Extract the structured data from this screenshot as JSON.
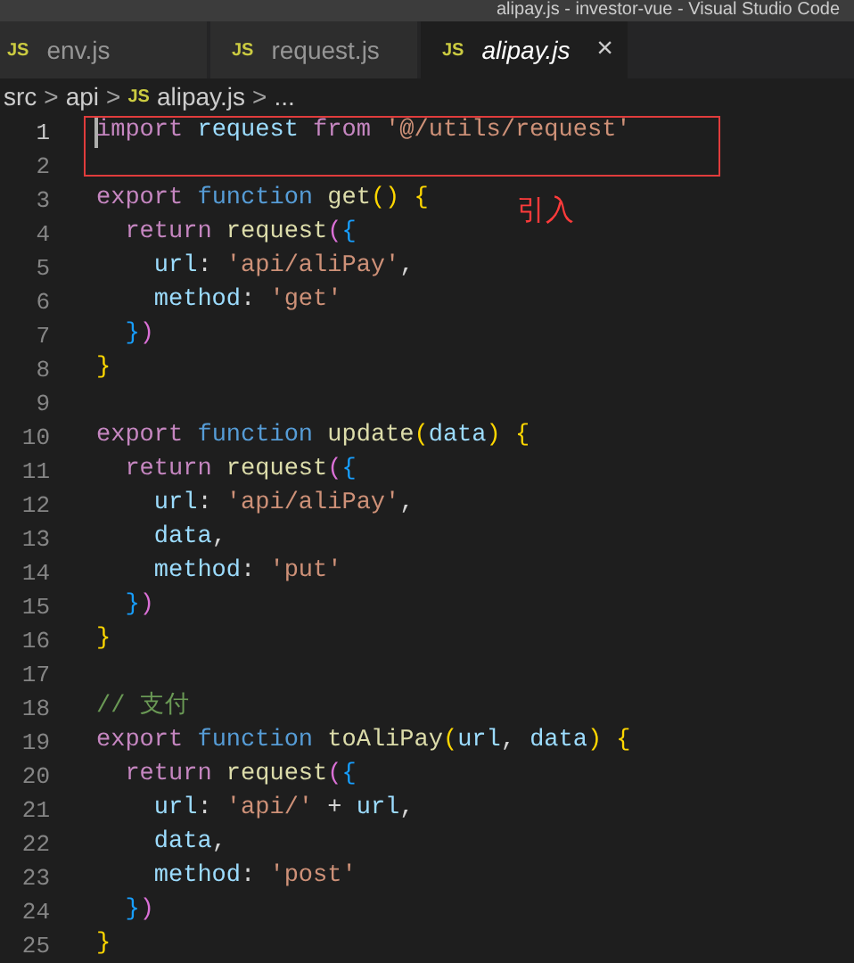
{
  "window": {
    "title": "alipay.js - investor-vue - Visual Studio Code"
  },
  "tabs": [
    {
      "icon": "JS",
      "label": "env.js",
      "selected": false
    },
    {
      "icon": "JS",
      "label": "request.js",
      "selected": false
    },
    {
      "icon": "JS",
      "label": "alipay.js",
      "selected": true,
      "close": "×"
    }
  ],
  "breadcrumb": [
    {
      "label": "src"
    },
    {
      "sep": ">"
    },
    {
      "label": "api"
    },
    {
      "sep": ">"
    },
    {
      "icon": "JS",
      "label": "alipay.js"
    },
    {
      "sep": ">"
    },
    {
      "label": "..."
    }
  ],
  "annotation": {
    "label": "引入"
  },
  "editor": {
    "lines": [
      {
        "number": "1",
        "active": true,
        "tokens": [
          {
            "text": "import ",
            "kind": "kw"
          },
          {
            "text": "request ",
            "kind": "var"
          },
          {
            "text": "from ",
            "kind": "kw"
          },
          {
            "text": "'@/utils/request'",
            "kind": "str"
          }
        ]
      },
      {
        "number": "2",
        "active": false
      },
      {
        "number": "3",
        "active": false,
        "tokens": [
          {
            "text": "export ",
            "kind": "kw"
          },
          {
            "text": "function ",
            "kind": "st"
          },
          {
            "text": "get",
            "kind": "fn"
          },
          {
            "text": "() {",
            "kind": "b1"
          }
        ]
      },
      {
        "number": "4",
        "active": false,
        "tokens": [
          {
            "text": "  return ",
            "kind": "kw"
          },
          {
            "text": "request",
            "kind": "fn"
          },
          {
            "text": "(",
            "kind": "b2"
          },
          {
            "text": "{",
            "kind": "b3"
          }
        ]
      },
      {
        "number": "5",
        "active": false,
        "tokens": [
          {
            "text": "    url",
            "kind": "var"
          },
          {
            "text": ": ",
            "kind": "p"
          },
          {
            "text": "'api/aliPay'",
            "kind": "str"
          },
          {
            "text": ",",
            "kind": "p"
          }
        ]
      },
      {
        "number": "6",
        "active": false,
        "tokens": [
          {
            "text": "    method",
            "kind": "var"
          },
          {
            "text": ": ",
            "kind": "p"
          },
          {
            "text": "'get'",
            "kind": "str"
          }
        ]
      },
      {
        "number": "7",
        "active": false,
        "tokens": [
          {
            "text": "  }",
            "kind": "b3"
          },
          {
            "text": ")",
            "kind": "b2"
          }
        ]
      },
      {
        "number": "8",
        "active": false,
        "tokens": [
          {
            "text": "}",
            "kind": "b1"
          }
        ]
      },
      {
        "number": "9",
        "active": false
      },
      {
        "number": "10",
        "active": false,
        "tokens": [
          {
            "text": "export ",
            "kind": "kw"
          },
          {
            "text": "function ",
            "kind": "st"
          },
          {
            "text": "update",
            "kind": "fn"
          },
          {
            "text": "(",
            "kind": "b1"
          },
          {
            "text": "data",
            "kind": "var"
          },
          {
            "text": ") {",
            "kind": "b1"
          }
        ]
      },
      {
        "number": "11",
        "active": false,
        "tokens": [
          {
            "text": "  return ",
            "kind": "kw"
          },
          {
            "text": "request",
            "kind": "fn"
          },
          {
            "text": "(",
            "kind": "b2"
          },
          {
            "text": "{",
            "kind": "b3"
          }
        ]
      },
      {
        "number": "12",
        "active": false,
        "tokens": [
          {
            "text": "    url",
            "kind": "var"
          },
          {
            "text": ": ",
            "kind": "p"
          },
          {
            "text": "'api/aliPay'",
            "kind": "str"
          },
          {
            "text": ",",
            "kind": "p"
          }
        ]
      },
      {
        "number": "13",
        "active": false,
        "tokens": [
          {
            "text": "    data",
            "kind": "var"
          },
          {
            "text": ",",
            "kind": "p"
          }
        ]
      },
      {
        "number": "14",
        "active": false,
        "tokens": [
          {
            "text": "    method",
            "kind": "var"
          },
          {
            "text": ": ",
            "kind": "p"
          },
          {
            "text": "'put'",
            "kind": "str"
          }
        ]
      },
      {
        "number": "15",
        "active": false,
        "tokens": [
          {
            "text": "  }",
            "kind": "b3"
          },
          {
            "text": ")",
            "kind": "b2"
          }
        ]
      },
      {
        "number": "16",
        "active": false,
        "tokens": [
          {
            "text": "}",
            "kind": "b1"
          }
        ]
      },
      {
        "number": "17",
        "active": false
      },
      {
        "number": "18",
        "active": false,
        "tokens": [
          {
            "text": "// 支付",
            "kind": "cm"
          }
        ]
      },
      {
        "number": "19",
        "active": false,
        "tokens": [
          {
            "text": "export ",
            "kind": "kw"
          },
          {
            "text": "function ",
            "kind": "st"
          },
          {
            "text": "toAliPay",
            "kind": "fn"
          },
          {
            "text": "(",
            "kind": "b1"
          },
          {
            "text": "url",
            "kind": "var"
          },
          {
            "text": ", ",
            "kind": "p"
          },
          {
            "text": "data",
            "kind": "var"
          },
          {
            "text": ") {",
            "kind": "b1"
          }
        ]
      },
      {
        "number": "20",
        "active": false,
        "tokens": [
          {
            "text": "  return ",
            "kind": "kw"
          },
          {
            "text": "request",
            "kind": "fn"
          },
          {
            "text": "(",
            "kind": "b2"
          },
          {
            "text": "{",
            "kind": "b3"
          }
        ]
      },
      {
        "number": "21",
        "active": false,
        "tokens": [
          {
            "text": "    url",
            "kind": "var"
          },
          {
            "text": ": ",
            "kind": "p"
          },
          {
            "text": "'api/'",
            "kind": "str"
          },
          {
            "text": " + ",
            "kind": "p"
          },
          {
            "text": "url",
            "kind": "var"
          },
          {
            "text": ",",
            "kind": "p"
          }
        ]
      },
      {
        "number": "22",
        "active": false,
        "tokens": [
          {
            "text": "    data",
            "kind": "var"
          },
          {
            "text": ",",
            "kind": "p"
          }
        ]
      },
      {
        "number": "23",
        "active": false,
        "tokens": [
          {
            "text": "    method",
            "kind": "var"
          },
          {
            "text": ": ",
            "kind": "p"
          },
          {
            "text": "'post'",
            "kind": "str"
          }
        ]
      },
      {
        "number": "24",
        "active": false,
        "tokens": [
          {
            "text": "  }",
            "kind": "b3"
          },
          {
            "text": ")",
            "kind": "b2"
          }
        ]
      },
      {
        "number": "25",
        "active": false,
        "tokens": [
          {
            "text": "}",
            "kind": "b1"
          }
        ]
      }
    ]
  }
}
